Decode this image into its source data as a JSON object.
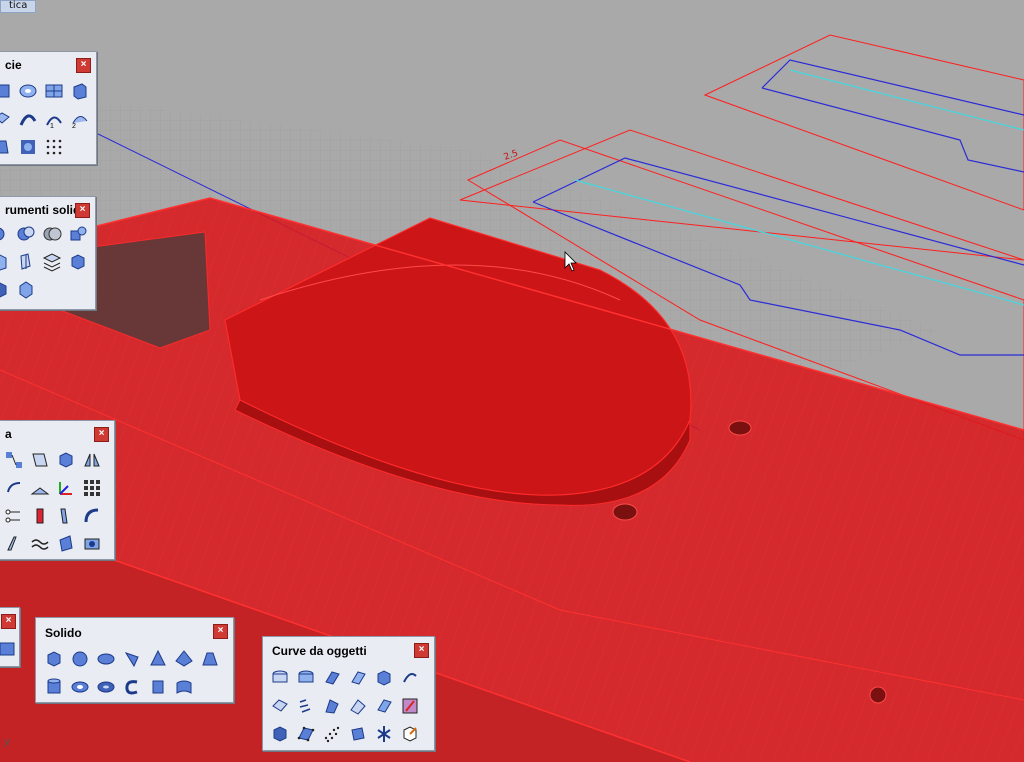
{
  "window_tab": {
    "label": "tica"
  },
  "colors": {
    "selection": "#ff1e1e",
    "curve_blue": "#2b2bd8",
    "curve_cyan": "#44d8e0",
    "background": "#a9a9a9",
    "panel_bg": "#e9edf3"
  },
  "panels": {
    "superficie": {
      "title": "cie",
      "close": "×"
    },
    "strumenti_solidi": {
      "title": "rumenti solidi",
      "close": "×"
    },
    "trasforma": {
      "title": "a",
      "close": "×"
    },
    "small": {
      "close": "×"
    },
    "solido": {
      "title": "Solido",
      "close": "×"
    },
    "curve_da_oggetti": {
      "title": "Curve da oggetti",
      "close": "×"
    }
  },
  "icon_number_labels": [
    "1",
    "2"
  ],
  "dimension_label": "2.5",
  "axis_label": "y"
}
